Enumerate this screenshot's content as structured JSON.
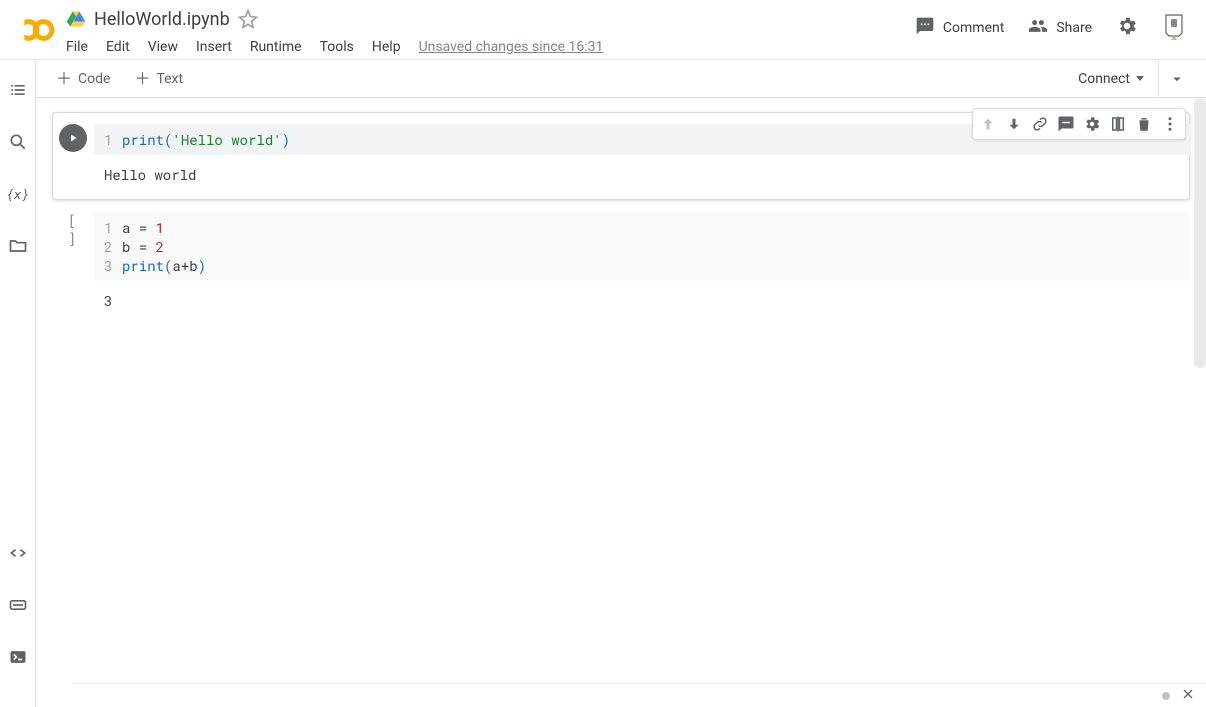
{
  "doc_title": "HelloWorld.ipynb",
  "save_status": "Unsaved changes since 16:31",
  "menus": {
    "file": "File",
    "edit": "Edit",
    "view": "View",
    "insert": "Insert",
    "runtime": "Runtime",
    "tools": "Tools",
    "help": "Help"
  },
  "header_actions": {
    "comment": "Comment",
    "share": "Share"
  },
  "toolbar": {
    "add_code": "Code",
    "add_text": "Text",
    "connect": "Connect"
  },
  "cells": [
    {
      "lines": [
        {
          "no": "1",
          "tokens": [
            {
              "t": "print",
              "c": "tok-fn"
            },
            {
              "t": "(",
              "c": "tok-paren"
            },
            {
              "t": "'Hello world'",
              "c": "tok-str"
            },
            {
              "t": ")",
              "c": "tok-paren"
            }
          ]
        }
      ],
      "output": "Hello world"
    },
    {
      "lines": [
        {
          "no": "1",
          "tokens": [
            {
              "t": "a ",
              "c": ""
            },
            {
              "t": "=",
              "c": "tok-op"
            },
            {
              "t": " ",
              "c": ""
            },
            {
              "t": "1",
              "c": "tok-num"
            }
          ]
        },
        {
          "no": "2",
          "tokens": [
            {
              "t": "b ",
              "c": ""
            },
            {
              "t": "=",
              "c": "tok-op"
            },
            {
              "t": " ",
              "c": ""
            },
            {
              "t": "2",
              "c": "tok-num"
            }
          ]
        },
        {
          "no": "3",
          "tokens": [
            {
              "t": "print",
              "c": "tok-fn"
            },
            {
              "t": "(",
              "c": "tok-paren"
            },
            {
              "t": "a",
              "c": ""
            },
            {
              "t": "+",
              "c": "tok-op"
            },
            {
              "t": "b",
              "c": ""
            },
            {
              "t": ")",
              "c": "tok-paren"
            }
          ]
        }
      ],
      "output": "3"
    }
  ],
  "run_placeholder": "[ ]"
}
